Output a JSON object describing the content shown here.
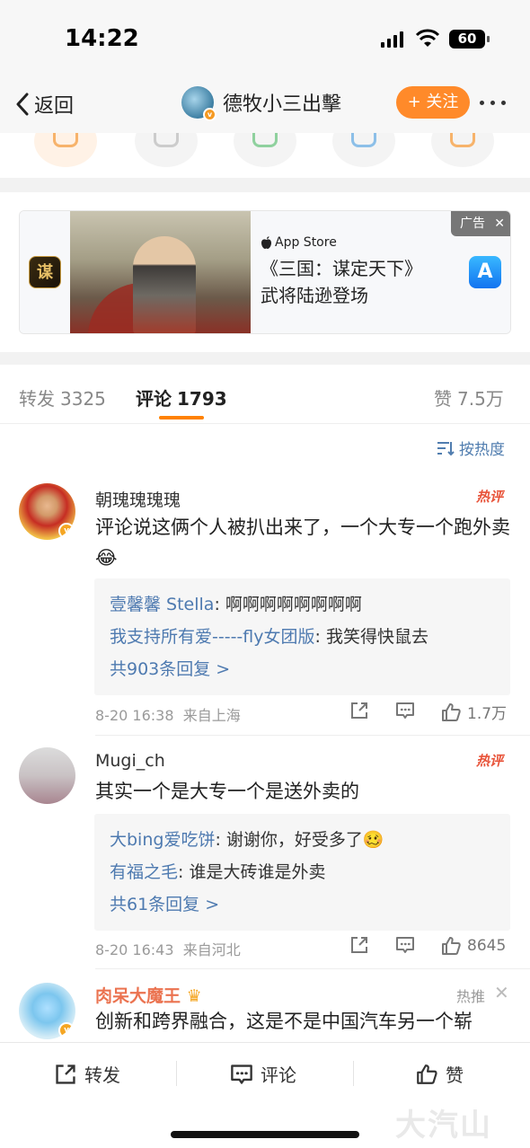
{
  "status_bar": {
    "time": "14:22",
    "battery": "60"
  },
  "nav": {
    "back_label": "返回",
    "title": "德牧小三出擊",
    "follow_label": "+ 关注"
  },
  "ad": {
    "store_label": "App Store",
    "line1": "《三国：谋定天下》",
    "line2": "武将陆逊登场",
    "tag": "广告",
    "app_glyph": "谋"
  },
  "tabs": {
    "repost_label": "转发",
    "repost_count": "3325",
    "comment_label": "评论",
    "comment_count": "1793",
    "like_label": "赞",
    "like_count": "7.5万"
  },
  "sort_label": "按热度",
  "comments": [
    {
      "name": "朝瑰瑰瑰瑰",
      "badge": "热评",
      "text": "评论说这俩个人被扒出来了，一个大专一个跑外卖",
      "emoji": "😂",
      "replies": [
        {
          "user": "壹馨馨 Stella",
          "text": ": 啊啊啊啊啊啊啊啊"
        },
        {
          "user": "我支持所有爱-----fly女团版",
          "text": ": 我笑得快鼠去"
        }
      ],
      "more": "共903条回复 >",
      "time": "8-20 16:38",
      "location": "来自上海",
      "likes": "1.7万"
    },
    {
      "name": "Mugi_ch",
      "badge": "热评",
      "text": "其实一个是大专一个是送外卖的",
      "replies": [
        {
          "user": "大bing爱吃饼",
          "text": ": 谢谢你，好受多了🥴"
        },
        {
          "user": "有福之毛",
          "text": ": 谁是大砖谁是外卖"
        }
      ],
      "more": "共61条回复 >",
      "time": "8-20 16:43",
      "location": "来自河北",
      "likes": "8645"
    },
    {
      "name": "肉呆大魔王",
      "badge": "热推",
      "text": "创新和跨界融合，这是不是中国汽车另一个崭"
    }
  ],
  "bottom_bar": {
    "repost": "转发",
    "comment": "评论",
    "like": "赞",
    "watermark": "大汽山"
  },
  "colors": {
    "accent": "#ff8200",
    "follow": "#ff8a2a",
    "link": "#4e7ab0",
    "hot": "#e85339"
  }
}
